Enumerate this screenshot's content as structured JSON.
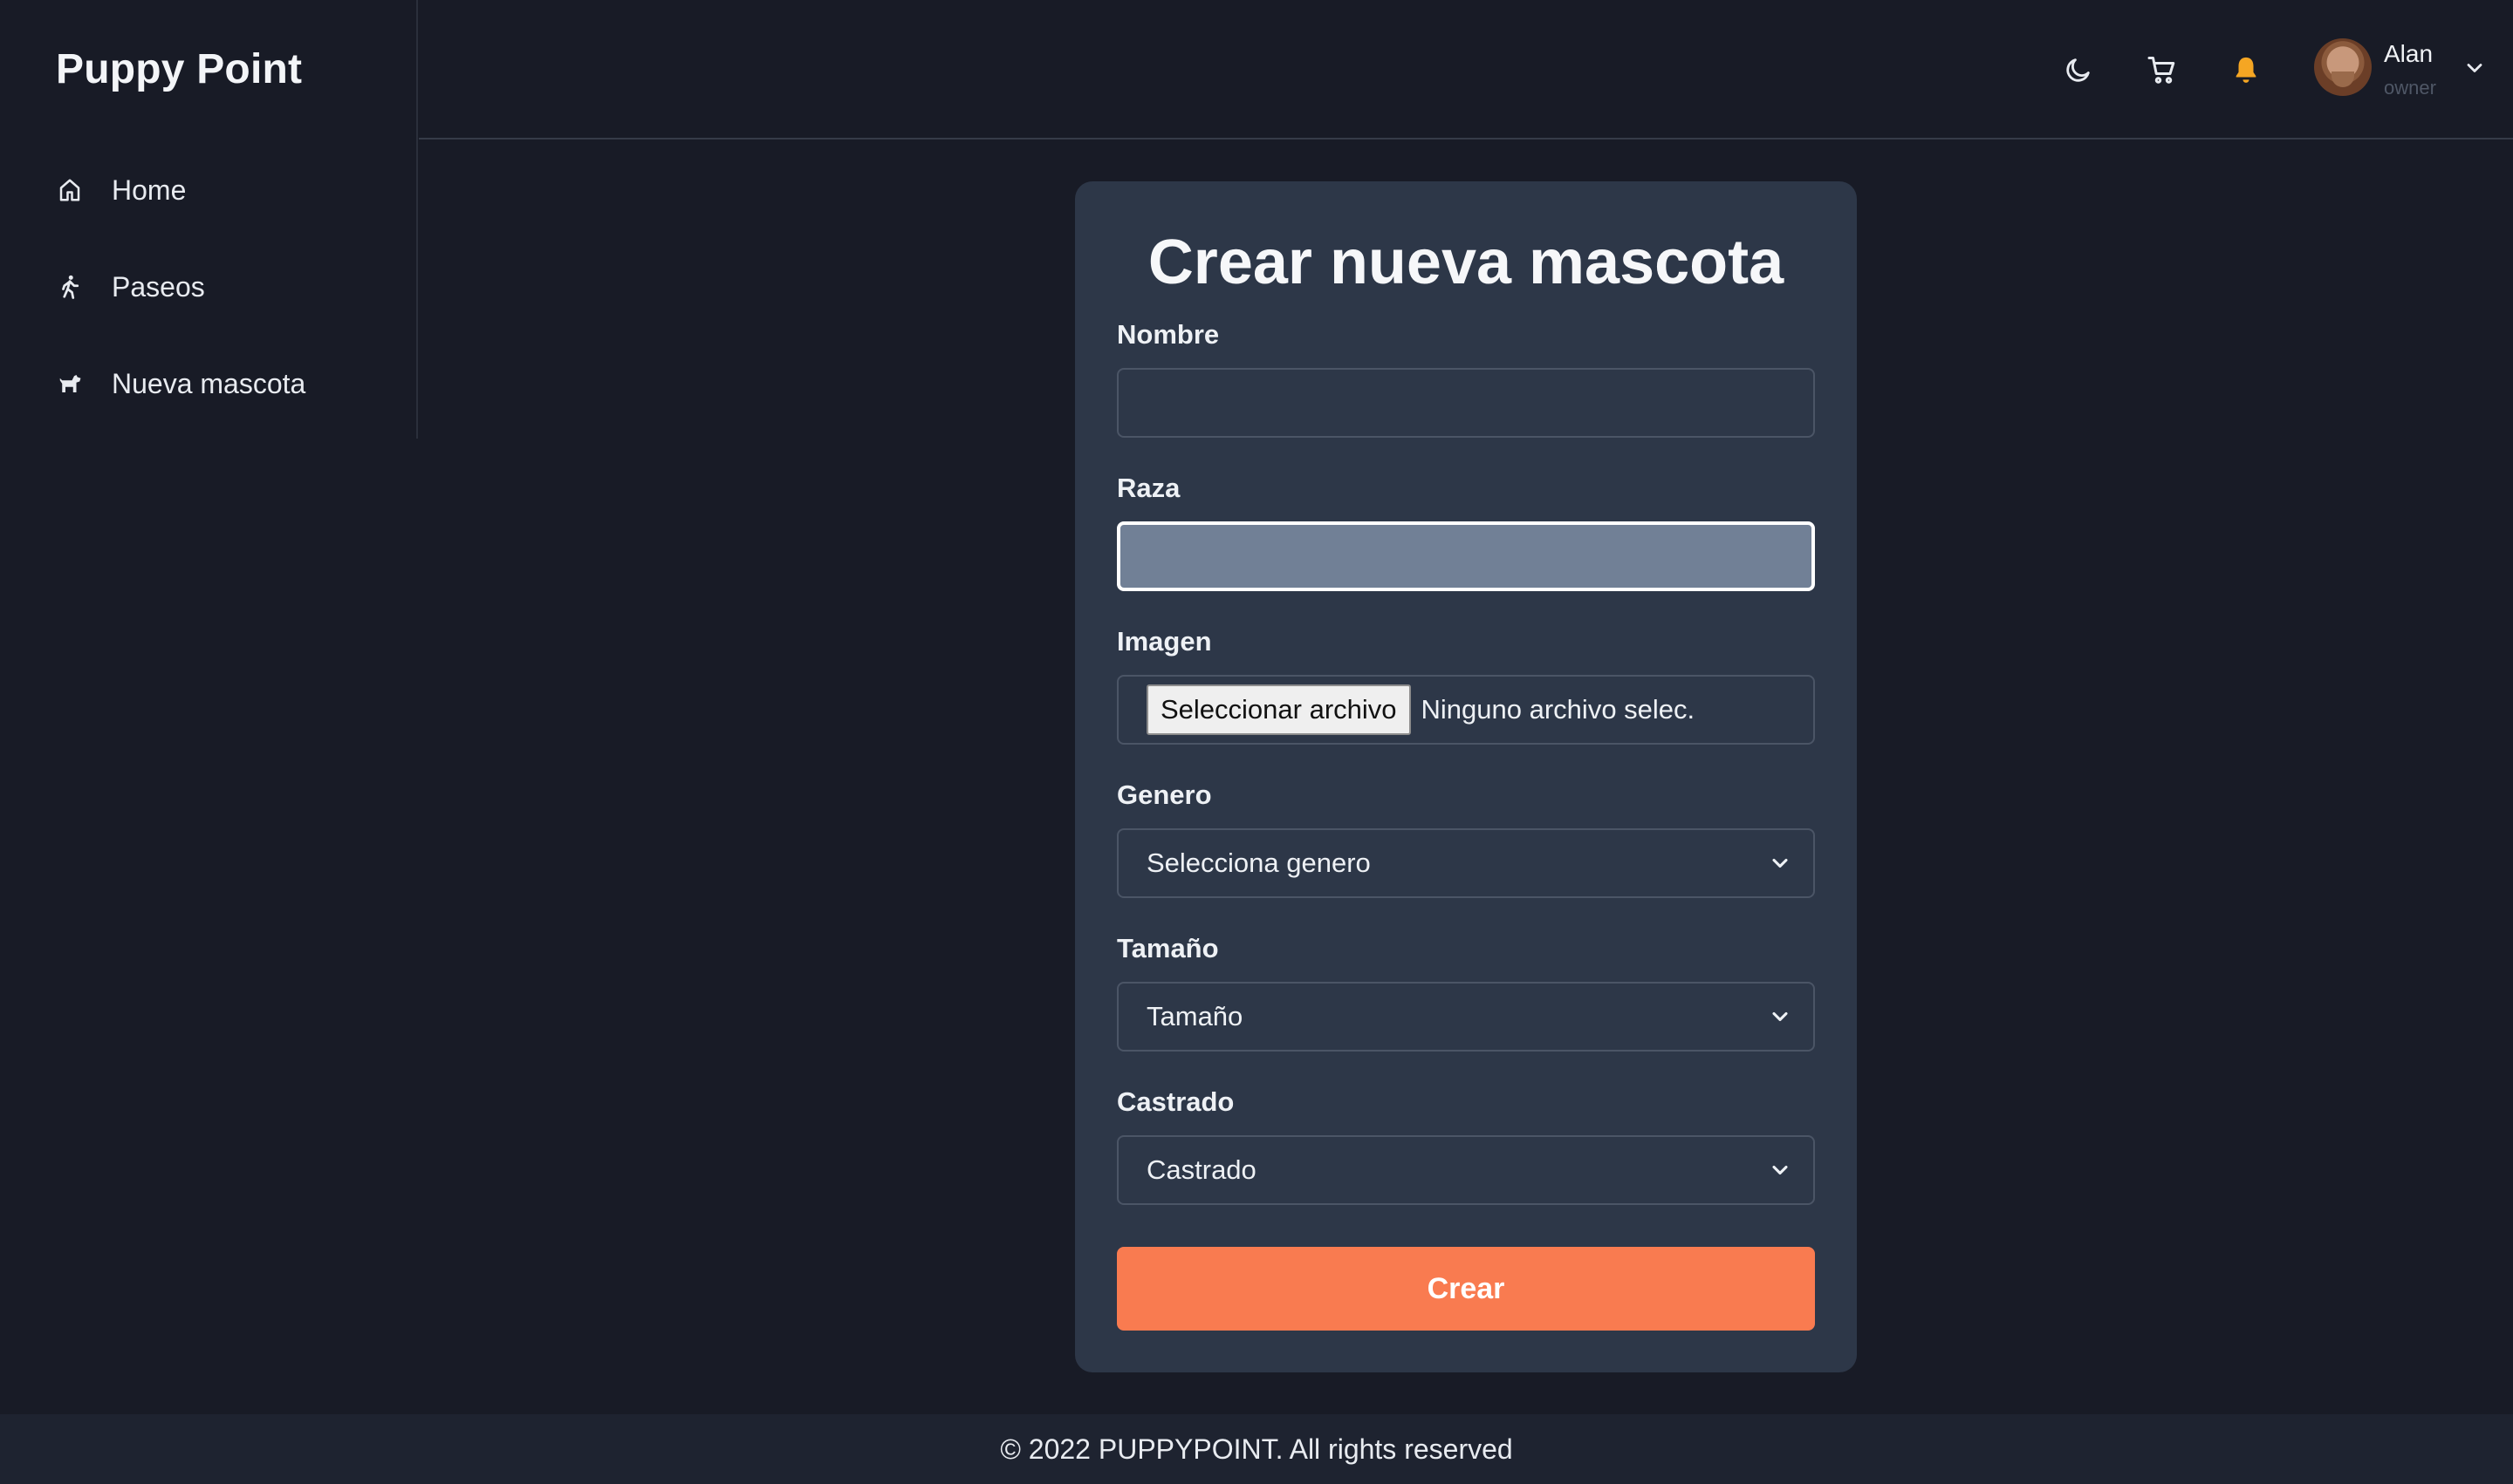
{
  "app": {
    "brand": "Puppy Point"
  },
  "sidebar": {
    "items": [
      {
        "label": "Home",
        "icon": "home-icon"
      },
      {
        "label": "Paseos",
        "icon": "walking-person-icon"
      },
      {
        "label": "Nueva mascota",
        "icon": "dog-icon"
      }
    ]
  },
  "header": {
    "icons": [
      "moon-icon",
      "cart-icon",
      "bell-icon"
    ],
    "bell_color": "#f5a623",
    "user": {
      "name": "Alan",
      "role": "owner"
    }
  },
  "form": {
    "title": "Crear nueva mascota",
    "fields": {
      "nombre": {
        "label": "Nombre",
        "value": ""
      },
      "raza": {
        "label": "Raza",
        "value": ""
      },
      "imagen": {
        "label": "Imagen",
        "button": "Seleccionar archivo",
        "status": "Ninguno archivo selec."
      },
      "genero": {
        "label": "Genero",
        "selected": "Selecciona genero"
      },
      "tamano": {
        "label": "Tamaño",
        "selected": "Tamaño"
      },
      "castrado": {
        "label": "Castrado",
        "selected": "Castrado"
      }
    },
    "submit_label": "Crear",
    "accent": "#f97b50"
  },
  "footer": {
    "text": "© 2022 PUPPYPOINT. All rights reserved"
  }
}
